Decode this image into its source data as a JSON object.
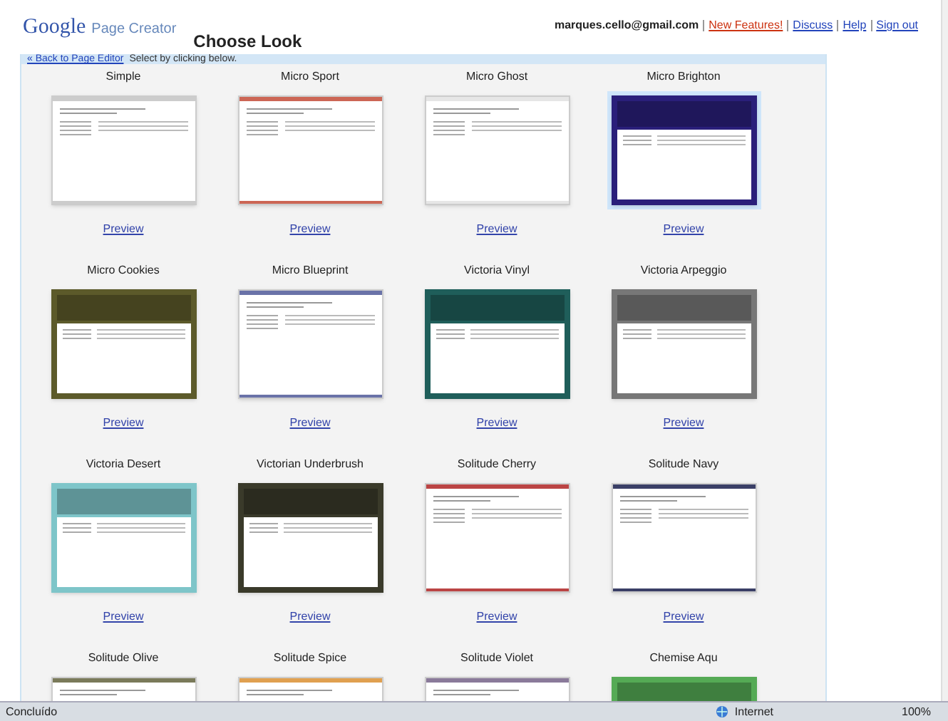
{
  "header": {
    "logo": "Google",
    "product": "Page Creator",
    "title": "Choose Look",
    "links": [
      {
        "text": "marques.cello@gmail.com",
        "kind": "account"
      },
      {
        "text": "New Features!",
        "kind": "highlight"
      },
      {
        "text": "Discuss",
        "kind": "link"
      },
      {
        "text": "Help",
        "kind": "link"
      },
      {
        "text": "Sign out",
        "kind": "link"
      }
    ]
  },
  "nav_bar": {
    "back_link": "« Back to Page Editor",
    "hint": "Select by clicking below."
  },
  "looks": [
    {
      "name": "Simple",
      "kind": "stripe",
      "color": "#cccccc",
      "selected": false,
      "preview": "Preview"
    },
    {
      "name": "Micro Sport",
      "kind": "stripe",
      "color": "#cc6655",
      "selected": false,
      "preview": "Preview"
    },
    {
      "name": "Micro Ghost",
      "kind": "stripe",
      "color": "#e6e6e6",
      "selected": false,
      "preview": "Preview"
    },
    {
      "name": "Micro Brighton",
      "kind": "frame",
      "color": "#2a1f7a",
      "selected": true,
      "preview": "Preview"
    },
    {
      "name": "Micro Cookies",
      "kind": "frame",
      "color": "#5c5a2a",
      "selected": false,
      "preview": "Preview"
    },
    {
      "name": "Micro Blueprint",
      "kind": "stripe",
      "color": "#6a72a8",
      "selected": false,
      "preview": "Preview"
    },
    {
      "name": "Victoria Vinyl",
      "kind": "frame",
      "color": "#1f5e5a",
      "selected": false,
      "preview": "Preview"
    },
    {
      "name": "Victoria Arpeggio",
      "kind": "frame",
      "color": "#777777",
      "selected": false,
      "preview": "Preview"
    },
    {
      "name": "Victoria Desert",
      "kind": "frame",
      "color": "#7ec5c9",
      "selected": false,
      "preview": "Preview"
    },
    {
      "name": "Victorian Underbrush",
      "kind": "frame",
      "color": "#3a3a2a",
      "selected": false,
      "preview": "Preview"
    },
    {
      "name": "Solitude Cherry",
      "kind": "stripe",
      "color": "#bb4444",
      "selected": false,
      "preview": "Preview"
    },
    {
      "name": "Solitude Navy",
      "kind": "stripe",
      "color": "#3a3f66",
      "selected": false,
      "preview": "Preview"
    },
    {
      "name": "Solitude Olive",
      "kind": "stripe",
      "color": "#7a7a5a",
      "selected": false
    },
    {
      "name": "Solitude Spice",
      "kind": "stripe",
      "color": "#e0a050",
      "selected": false
    },
    {
      "name": "Solitude Violet",
      "kind": "stripe",
      "color": "#8a7a9a",
      "selected": false
    },
    {
      "name": "Chemise Aqu",
      "kind": "frame",
      "color": "#55aa55",
      "selected": false
    }
  ],
  "status_bar": {
    "status": "Concluído",
    "zone": "Internet",
    "zoom": "100%"
  }
}
